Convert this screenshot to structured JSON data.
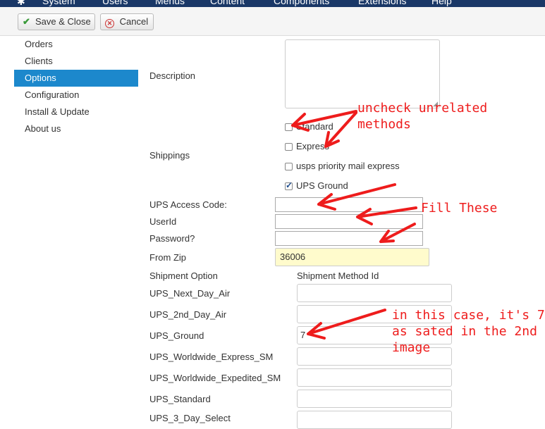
{
  "topmenu": [
    "System",
    "Users",
    "Menus",
    "Content",
    "Components",
    "Extensions",
    "Help"
  ],
  "toolbar": {
    "save_label": "Save & Close",
    "cancel_label": "Cancel"
  },
  "sidebar": {
    "items": [
      {
        "label": "Orders",
        "active": false
      },
      {
        "label": "Clients",
        "active": false
      },
      {
        "label": "Options",
        "active": true
      },
      {
        "label": "Configuration",
        "active": false
      },
      {
        "label": "Install & Update",
        "active": false
      },
      {
        "label": "About us",
        "active": false
      }
    ]
  },
  "form": {
    "description_label": "Description",
    "description_value": "",
    "shippings_label": "Shippings",
    "shippings": [
      {
        "label": "Standard",
        "checked": false
      },
      {
        "label": "Express",
        "checked": false
      },
      {
        "label": "usps priority mail express",
        "checked": false
      },
      {
        "label": "UPS Ground",
        "checked": true
      }
    ],
    "ups_access_code_label": "UPS Access Code:",
    "ups_access_code_value": "",
    "userid_label": "UserId",
    "userid_value": "",
    "password_label": "Password?",
    "password_value": "",
    "from_zip_label": "From Zip",
    "from_zip_value": "36006",
    "shipment_option_header": "Shipment Option",
    "shipment_method_id_header": "Shipment Method Id",
    "shipment_options": [
      {
        "label": "UPS_Next_Day_Air",
        "value": ""
      },
      {
        "label": "UPS_2nd_Day_Air",
        "value": ""
      },
      {
        "label": "UPS_Ground",
        "value": "7"
      },
      {
        "label": "UPS_Worldwide_Express_SM",
        "value": ""
      },
      {
        "label": "UPS_Worldwide_Expedited_SM",
        "value": ""
      },
      {
        "label": "UPS_Standard",
        "value": ""
      },
      {
        "label": "UPS_3_Day_Select",
        "value": ""
      }
    ]
  },
  "annotations": {
    "uncheck_line1": "uncheck unrelated",
    "uncheck_line2": "methods",
    "fill_these": "Fill These",
    "case_line1": "in this case, it's 7,",
    "case_line2": "as sated in the 2nd",
    "case_line3": "image",
    "color": "#ee1c1c"
  },
  "colors": {
    "accent": "#1c88cc",
    "topbar": "#1a3867",
    "zip_bg": "#fffbcc"
  }
}
